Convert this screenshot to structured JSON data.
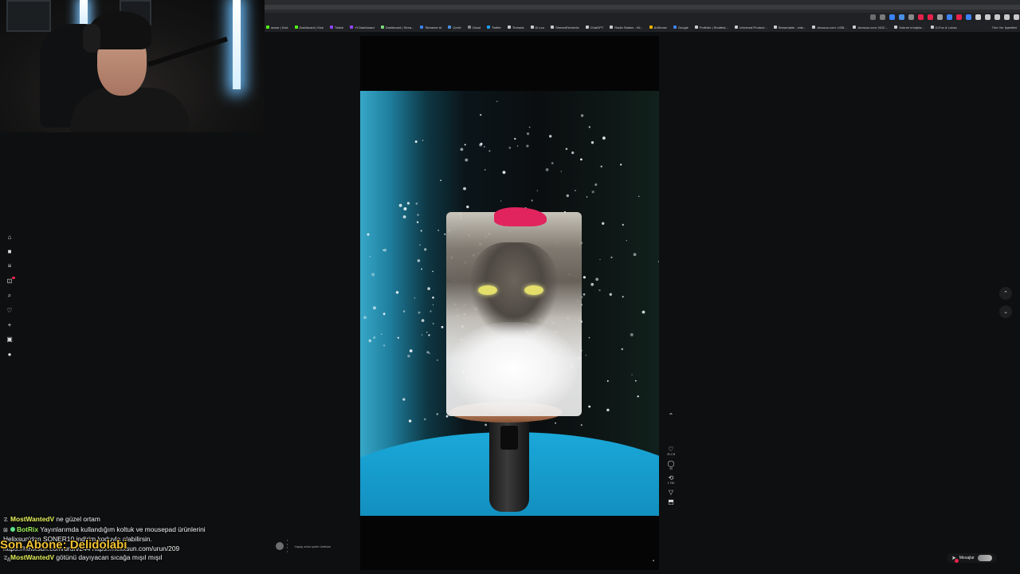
{
  "browser": {
    "bookmarks": [
      {
        "label": "ararar | Kick",
        "color": "#53fc18"
      },
      {
        "label": "Dashboard | Kick",
        "color": "#53fc18"
      },
      {
        "label": "Twitch",
        "color": "#9146ff"
      },
      {
        "label": "Yt Dashboard",
        "color": "#9146ff"
      },
      {
        "label": "Dashboard | Strea...",
        "color": "#7ad97a"
      },
      {
        "label": "Streamer Ai",
        "color": "#3b82f6"
      },
      {
        "label": "Çeviri",
        "color": "#4a90e2"
      },
      {
        "label": "Claud",
        "color": "#888888"
      },
      {
        "label": "Twitter",
        "color": "#1da1f2"
      },
      {
        "label": "Threads",
        "color": "#cccccc"
      },
      {
        "label": "Dr.Lcu",
        "color": "#cccccc"
      },
      {
        "label": "StreamElements",
        "color": "#cccccc"
      },
      {
        "label": "ChatGPT",
        "color": "#cccccc"
      },
      {
        "label": "Radio Station - Kil...",
        "color": "#cccccc"
      },
      {
        "label": "AdSense",
        "color": "#f4b400"
      },
      {
        "label": "Google",
        "color": "#4285f4"
      },
      {
        "label": "Portfolio | Shuttest...",
        "color": "#cccccc"
      },
      {
        "label": "Universal Product...",
        "color": "#cccccc"
      },
      {
        "label": "Streamable - vide...",
        "color": "#cccccc"
      },
      {
        "label": "Amazon.com: USB...",
        "color": "#cccccc"
      },
      {
        "label": "Amazon.com: NOC...",
        "color": "#cccccc"
      },
      {
        "label": "Subnet a tarjeta...",
        "color": "#cccccc"
      },
      {
        "label": "D-Fox & Lohan",
        "color": "#cccccc"
      }
    ],
    "all_bookmarks": "Tüm Yer İşaretleri",
    "toolbar_colors": [
      "#6b6b6b",
      "#7a7a7a",
      "#3b82f6",
      "#4a90e2",
      "#8a8a8a",
      "#e7224c",
      "#e7224c",
      "#9c9c9c",
      "#3b82f6",
      "#e7224c",
      "#3b82f6",
      "#d0d0d0",
      "#c8c8c8",
      "#c8c8c8",
      "#c8c8c8",
      "#c8c8c8"
    ]
  },
  "sidebar": {
    "items": [
      {
        "name": "home-icon",
        "glyph": "⌂"
      },
      {
        "name": "following-icon",
        "glyph": "■"
      },
      {
        "name": "explore-icon",
        "glyph": "≡"
      },
      {
        "name": "live-icon",
        "glyph": "⊡"
      },
      {
        "name": "search-icon",
        "glyph": "⌕"
      },
      {
        "name": "favorites-icon",
        "glyph": "♡"
      },
      {
        "name": "upload-icon",
        "glyph": "+"
      },
      {
        "name": "inbox-icon",
        "glyph": "▣"
      },
      {
        "name": "profile-icon",
        "glyph": "●"
      }
    ]
  },
  "video": {
    "actions": [
      {
        "name": "chevron-up-icon",
        "glyph": "⌃",
        "count": ""
      },
      {
        "name": "like-icon",
        "glyph": "♡",
        "count": "30.4 B"
      },
      {
        "name": "comment-icon",
        "glyph": "◯",
        "count": "45"
      },
      {
        "name": "repost-icon",
        "glyph": "⟲",
        "count": "1.760"
      },
      {
        "name": "share-icon",
        "glyph": "▽",
        "count": ""
      },
      {
        "name": "bookmark-icon",
        "glyph": "⬒",
        "count": ""
      }
    ],
    "ai_label": "Yapay zeka içerik üreticisi"
  },
  "messages": {
    "label": "Mesajlar"
  },
  "chat": {
    "lines": [
      {
        "icon": "☡",
        "user": "MostWantedV",
        "user_color": "yellow",
        "text": "ne güzel ortam"
      },
      {
        "icon": "⊠",
        "user": "BotRix",
        "user_color": "green",
        "text": "Yayınlarımda kullandığım koltuk ve mousepad ürünlerini"
      },
      {
        "icon": "",
        "user": "",
        "user_color": "",
        "text": "Helixsun'dan SONER10 indirim koduyla alabilirsin."
      },
      {
        "icon": "",
        "user": "",
        "user_color": "",
        "text": "https://helixsun.com/urun/244 https://helixsun.com/urun/209"
      },
      {
        "icon": "☡",
        "user": "MostWantedV",
        "user_color": "yellow",
        "text": "götünü dayıyacan sıcağa mışıl mışıl"
      }
    ],
    "sub_overlay": "Son Abone: Delidolabi"
  }
}
